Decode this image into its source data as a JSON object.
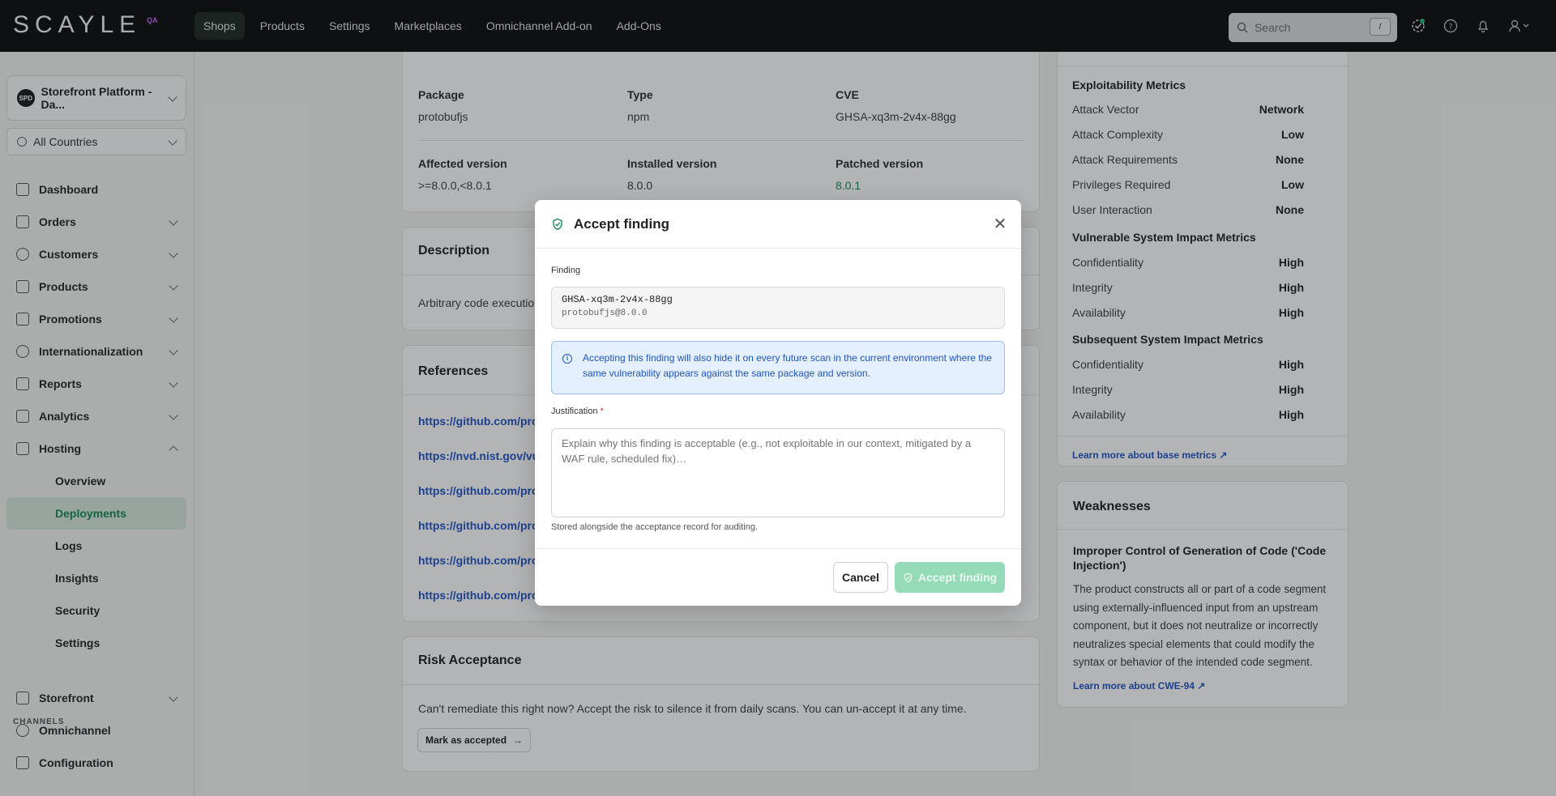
{
  "brand": {
    "logo": "SCAYLE",
    "env": "QA"
  },
  "topnav": [
    "Shops",
    "Products",
    "Settings",
    "Marketplaces",
    "Omnichannel Add-on",
    "Add-Ons"
  ],
  "search": {
    "placeholder": "Search",
    "shortcut": "/"
  },
  "sidebar": {
    "shop": {
      "avatar": "SPD",
      "name": "Storefront Platform - Da..."
    },
    "country": "All Countries",
    "items": [
      {
        "label": "Dashboard",
        "icon": "chart-icon"
      },
      {
        "label": "Orders",
        "icon": "orders-icon"
      },
      {
        "label": "Customers",
        "icon": "users-icon"
      },
      {
        "label": "Products",
        "icon": "shirt-icon"
      },
      {
        "label": "Promotions",
        "icon": "ticket-icon"
      },
      {
        "label": "Internationalization",
        "icon": "globe-icon"
      },
      {
        "label": "Reports",
        "icon": "bar-chart-icon"
      },
      {
        "label": "Analytics",
        "icon": "analytics-icon"
      },
      {
        "label": "Hosting",
        "icon": "server-icon"
      }
    ],
    "hosting_sub": [
      "Overview",
      "Deployments",
      "Logs",
      "Insights",
      "Security",
      "Settings"
    ],
    "channels_label": "CHANNELS",
    "channels": [
      {
        "label": "Storefront"
      },
      {
        "label": "Omnichannel"
      },
      {
        "label": "Configuration"
      }
    ]
  },
  "package": {
    "package_label": "Package",
    "package": "protobufjs",
    "type_label": "Type",
    "type": "npm",
    "cve_label": "CVE",
    "cve": "GHSA-xq3m-2v4x-88gg",
    "affected_label": "Affected version",
    "affected": ">=8.0.0,<8.0.1",
    "installed_label": "Installed version",
    "installed": "8.0.0",
    "patched_label": "Patched version",
    "patched": "8.0.1"
  },
  "description": {
    "title": "Description",
    "text": "Arbitrary code execution"
  },
  "references": {
    "title": "References",
    "links": [
      "https://github.com/prot",
      "https://nvd.nist.gov/vuln",
      "https://github.com/prot",
      "https://github.com/prot",
      "https://github.com/prot",
      "https://github.com/prot"
    ]
  },
  "risk": {
    "title": "Risk Acceptance",
    "text": "Can't remediate this right now? Accept the risk to silence it from daily scans. You can un-accept it at any time.",
    "button": "Mark as accepted"
  },
  "metrics": {
    "exploit_title": "Exploitability Metrics",
    "exploit": [
      {
        "k": "Attack Vector",
        "v": "Network"
      },
      {
        "k": "Attack Complexity",
        "v": "Low"
      },
      {
        "k": "Attack Requirements",
        "v": "None"
      },
      {
        "k": "Privileges Required",
        "v": "Low"
      },
      {
        "k": "User Interaction",
        "v": "None"
      }
    ],
    "vuln_title": "Vulnerable System Impact Metrics",
    "vuln": [
      {
        "k": "Confidentiality",
        "v": "High"
      },
      {
        "k": "Integrity",
        "v": "High"
      },
      {
        "k": "Availability",
        "v": "High"
      }
    ],
    "subseq_title": "Subsequent System Impact Metrics",
    "subseq": [
      {
        "k": "Confidentiality",
        "v": "High"
      },
      {
        "k": "Integrity",
        "v": "High"
      },
      {
        "k": "Availability",
        "v": "High"
      }
    ],
    "learn": "Learn more about base metrics"
  },
  "weaknesses": {
    "title": "Weaknesses",
    "name": "Improper Control of Generation of Code ('Code Injection')",
    "text": "The product constructs all or part of a code segment using externally-influenced input from an upstream component, but it does not neutralize or incorrectly neutralizes special elements that could modify the syntax or behavior of the intended code segment.",
    "learn": "Learn more about CWE-94"
  },
  "modal": {
    "title": "Accept finding",
    "finding_label": "Finding",
    "finding_id": "GHSA-xq3m-2v4x-88gg",
    "finding_pkg": "protobufjs@8.0.0",
    "info": "Accepting this finding will also hide it on every future scan in the current environment where the same vulnerability appears against the same package and version.",
    "justification_label": "Justification",
    "required_mark": "*",
    "placeholder": "Explain why this finding is acceptable (e.g., not exploitable in our context, mitigated by a WAF rule, scheduled fix)…",
    "help": "Stored alongside the acceptance record for auditing.",
    "cancel": "Cancel",
    "accept": "Accept finding"
  },
  "colors": {
    "accent": "#198a55",
    "link": "#2355c7",
    "accept_disabled": "#95dbb7"
  }
}
